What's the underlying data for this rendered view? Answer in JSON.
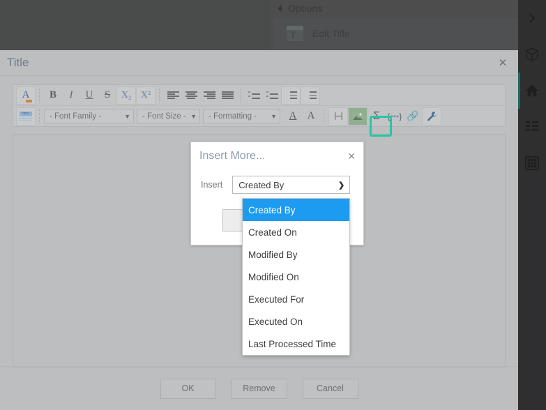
{
  "background": {
    "options_panel": {
      "title": "Options",
      "collapse_icon": "triangle-collapse-icon",
      "items": [
        {
          "label": "Edit Title",
          "icon": "edit-title-icon"
        }
      ]
    },
    "right_rail": {
      "items": [
        {
          "name": "expand-chevron-icon",
          "glyph": "chevron-right"
        },
        {
          "name": "cube-icon",
          "glyph": "cube"
        },
        {
          "name": "home-icon",
          "glyph": "home",
          "active": true
        },
        {
          "name": "list-icon",
          "glyph": "list"
        },
        {
          "name": "grid-icon",
          "glyph": "grid"
        }
      ],
      "active_indicator_color": "#19a08a"
    }
  },
  "editor": {
    "title": "Title",
    "close_label": "✕",
    "toolbar_row1": [
      {
        "name": "font-color-a-icon",
        "label": "A"
      },
      {
        "name": "bold-button",
        "label": "B"
      },
      {
        "name": "italic-button",
        "label": "I"
      },
      {
        "name": "underline-button",
        "label": "U"
      },
      {
        "name": "strikethrough-button",
        "label": "S"
      },
      {
        "name": "subscript-button",
        "label": "X₂"
      },
      {
        "name": "superscript-button",
        "label": "X²"
      },
      {
        "name": "align-left-button",
        "label": ""
      },
      {
        "name": "align-center-button",
        "label": ""
      },
      {
        "name": "align-right-button",
        "label": ""
      },
      {
        "name": "align-justify-button",
        "label": ""
      },
      {
        "name": "numbered-list-button",
        "label": ""
      },
      {
        "name": "bulleted-list-button",
        "label": ""
      },
      {
        "name": "indent-button",
        "label": ""
      },
      {
        "name": "outdent-button",
        "label": ""
      }
    ],
    "toolbar_row2": {
      "html_source_label": "html",
      "font_family": "- Font Family -",
      "font_size": "- Font Size -",
      "formatting": "- Formatting -",
      "text_color_label": "A",
      "highlight_color_label": "A",
      "icons": [
        {
          "name": "page-break-icon"
        },
        {
          "name": "insert-image-icon"
        },
        {
          "name": "insert-formula-icon",
          "glyph": "Σ"
        },
        {
          "name": "insert-variable-icon",
          "glyph": "{…}"
        },
        {
          "name": "insert-link-icon",
          "glyph": "⚭"
        },
        {
          "name": "insert-more-wrench-icon",
          "highlighted": true
        }
      ]
    },
    "footer_buttons": [
      {
        "label": "OK",
        "name": "ok-button"
      },
      {
        "label": "Remove",
        "name": "remove-button"
      },
      {
        "label": "Cancel",
        "name": "cancel-button"
      }
    ]
  },
  "insert_more_dialog": {
    "title": "Insert More...",
    "close_label": "✕",
    "field_label": "Insert",
    "selected_value": "Created By",
    "options": [
      "Created By",
      "Created On",
      "Modified By",
      "Modified On",
      "Executed For",
      "Executed On",
      "Last Processed Time"
    ],
    "selected_index": 0
  },
  "colors": {
    "highlight_ring": "#26c6a4",
    "dropdown_selected": "#1d9bf0",
    "editor_title_text": "#6a7c90",
    "modal_title_text": "#8b9cb0",
    "rail_active": "#19a08a"
  }
}
